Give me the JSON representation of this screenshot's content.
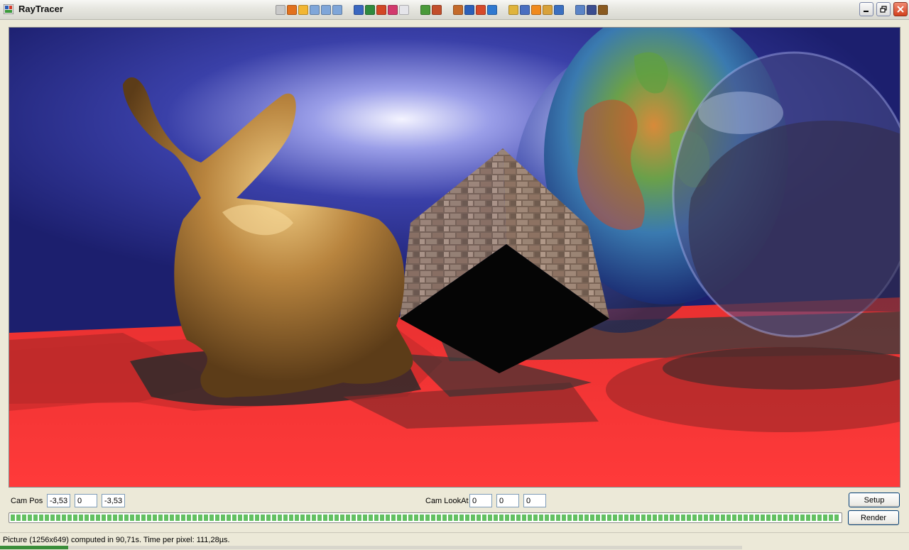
{
  "window": {
    "title": "RayTracer",
    "controls": {
      "minimize": "minimize-icon",
      "maximize": "restore-icon",
      "close": "close-icon"
    }
  },
  "tray_icons": [
    {
      "name": "trophy-icon",
      "color": "#c9c9c9"
    },
    {
      "name": "firefox-icon",
      "color": "#e2711d"
    },
    {
      "name": "sun-icon",
      "color": "#f2b632"
    },
    {
      "name": "folder-icon",
      "color": "#7fa6d9"
    },
    {
      "name": "folder-icon",
      "color": "#7fa6d9"
    },
    {
      "name": "folder-icon",
      "color": "#7fa6d9"
    },
    {
      "name": "gap",
      "color": ""
    },
    {
      "name": "word-icon",
      "color": "#3a67c0"
    },
    {
      "name": "excel-icon",
      "color": "#2f8a3e"
    },
    {
      "name": "powerpoint-icon",
      "color": "#d24726"
    },
    {
      "name": "tool-icon",
      "color": "#d23a6d"
    },
    {
      "name": "notepad-icon",
      "color": "#e5e5ea"
    },
    {
      "name": "gap",
      "color": ""
    },
    {
      "name": "paint-icon",
      "color": "#4a9a3a"
    },
    {
      "name": "brush-icon",
      "color": "#c24e2b"
    },
    {
      "name": "gap",
      "color": ""
    },
    {
      "name": "sync-icon",
      "color": "#c46a2a"
    },
    {
      "name": "globe-icon",
      "color": "#2c5fb8"
    },
    {
      "name": "mail-icon",
      "color": "#d64a2a"
    },
    {
      "name": "ie-icon",
      "color": "#2f79d0"
    },
    {
      "name": "gap",
      "color": ""
    },
    {
      "name": "pencil-icon",
      "color": "#e0b43b"
    },
    {
      "name": "network-icon",
      "color": "#4a6fc0"
    },
    {
      "name": "vlc-icon",
      "color": "#f08a1c"
    },
    {
      "name": "media-icon",
      "color": "#d8a23a"
    },
    {
      "name": "player-icon",
      "color": "#3a6fc0"
    },
    {
      "name": "gap",
      "color": ""
    },
    {
      "name": "document-icon",
      "color": "#5b84c7"
    },
    {
      "name": "ts-icon",
      "color": "#3b4d8f"
    },
    {
      "name": "wow-icon",
      "color": "#8a5a20"
    }
  ],
  "render": {
    "image": "raytraced-scene",
    "colors": {
      "sky": "#1c1f6e",
      "floor": "#f03232",
      "bunny": "#a87635",
      "box": "#6e5a4e",
      "shadow": "#3a3a3a"
    }
  },
  "controls": {
    "cam_pos_label": "Cam Pos",
    "cam_pos": {
      "x": "-3,53!",
      "y": "0",
      "z": "-3,53!"
    },
    "cam_lookat_label": "Cam LookAt",
    "cam_lookat": {
      "x": "0",
      "y": "0",
      "z": "0"
    },
    "setup_label": "Setup",
    "render_label": "Render",
    "progress": 1.0
  },
  "status": {
    "text": "Picture (1256x649) computed in 90,71s. Time per pixel: 111,28µs."
  }
}
